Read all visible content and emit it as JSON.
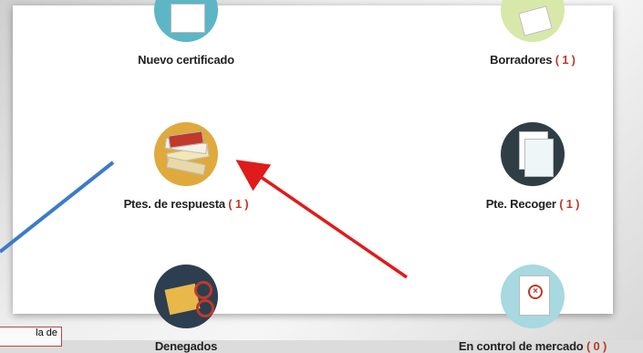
{
  "tiles": {
    "new": {
      "label": "Nuevo certificado",
      "count": ""
    },
    "drafts": {
      "label": "Borradores",
      "count": "( 1 )"
    },
    "pending": {
      "label": "Ptes. de respuesta",
      "count": "( 1 )"
    },
    "pickup": {
      "label": "Pte. Recoger",
      "count": "( 1 )"
    },
    "denied": {
      "label": "Denegados",
      "count": ""
    },
    "market": {
      "label": "En control de mercado",
      "count": "( 0 )"
    }
  },
  "partial_button": {
    "label": "la de"
  },
  "colors": {
    "accent_count": "#c0392b",
    "arrow_red": "#e01b1b",
    "arrow_blue": "#3b7bc8"
  }
}
